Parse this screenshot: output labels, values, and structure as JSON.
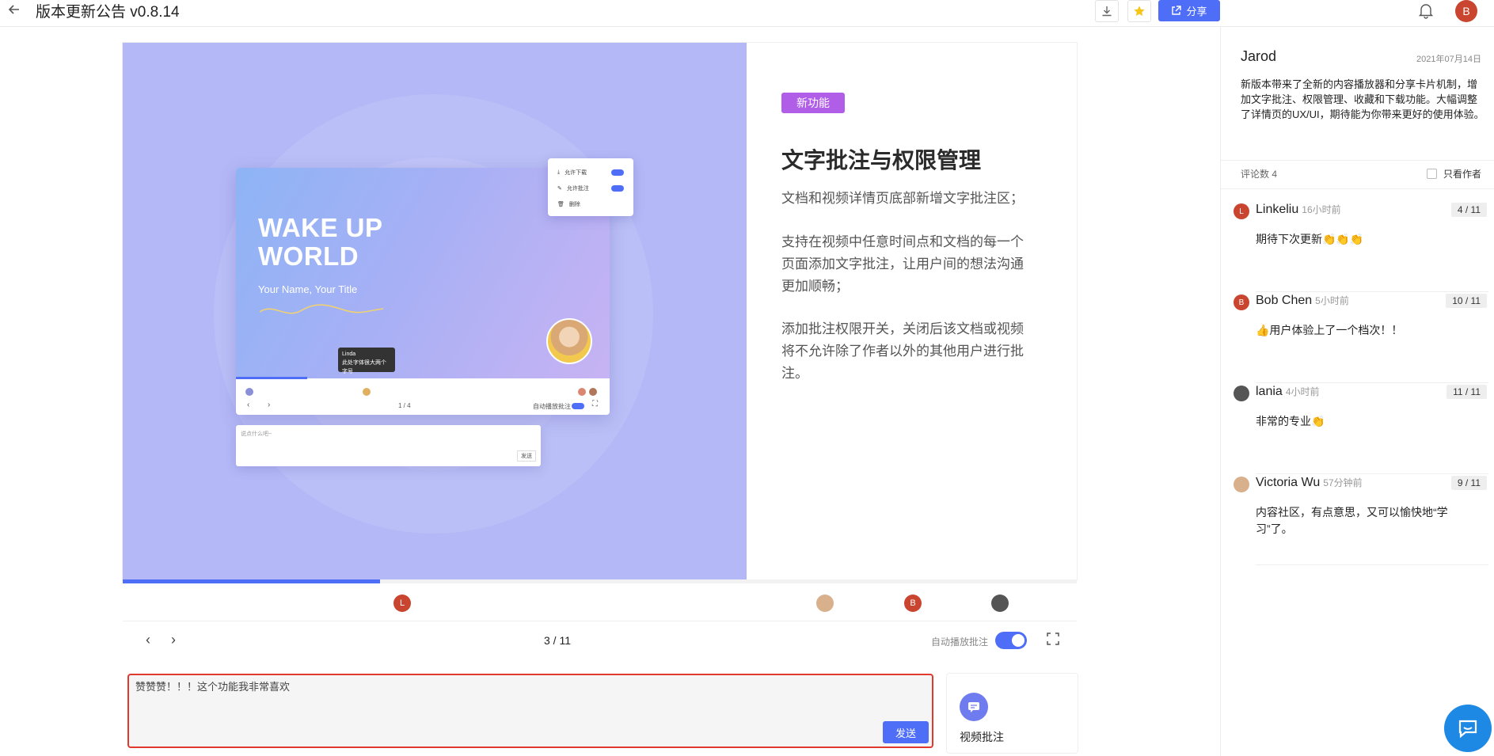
{
  "header": {
    "title": "版本更新公告 v0.8.14",
    "share_label": "分享",
    "user_initial": "B"
  },
  "slide": {
    "mock": {
      "headline_1": "WAKE UP",
      "headline_2": "WORLD",
      "subtitle": "Your Name, Your Title",
      "menu": [
        "允许下载",
        "允许批注",
        "删除"
      ],
      "tooltip_name": "Linda",
      "tooltip_text": "此处字体很大两个字号",
      "page": "1 / 4",
      "autoplay": "自动播放批注",
      "input_placeholder": "说点什么吧~",
      "send": "发送"
    },
    "badge": "新功能",
    "heading": "文字批注与权限管理",
    "paragraphs": [
      "文档和视频详情页底部新增文字批注区；",
      "支持在视频中任意时间点和文档的每一个页面添加文字批注，让用户间的想法沟通更加顺畅；",
      "添加批注权限开关，关闭后该文档或视频将不允许除了作者以外的其他用户进行批注。"
    ]
  },
  "player": {
    "progress_fraction": 0.27,
    "page_indicator": "3 / 11",
    "autoplay_label": "自动播放批注",
    "autoplay_on": true,
    "markers": [
      {
        "initial": "L",
        "color": "#c9452f"
      },
      {
        "initial": "",
        "color": "#d9b08c"
      },
      {
        "initial": "B",
        "color": "#c9452f"
      },
      {
        "initial": "",
        "color": "#555555"
      }
    ]
  },
  "comment_input": {
    "value": "赞赞赞！！！这个功能我非常喜欢",
    "send_label": "发送"
  },
  "video_annotation": {
    "label": "视频批注"
  },
  "panel": {
    "author": "Jarod",
    "date": "2021年07月14日",
    "description": "新版本带来了全新的内容播放器和分享卡片机制，增加文字批注、权限管理、收藏和下载功能。大幅调整了详情页的UX/UI，期待能为你带来更好的使用体验。",
    "comment_count": "评论数 4",
    "only_author": "只看作者",
    "comments": [
      {
        "initial": "L",
        "color": "#c9452f",
        "name": "Linkeliu",
        "time": "16小时前",
        "page": "4 / 11",
        "text": "期待下次更新👏👏👏"
      },
      {
        "initial": "B",
        "color": "#c9452f",
        "name": "Bob Chen",
        "time": "5小时前",
        "page": "10 / 11",
        "text": "👍用户体验上了一个档次！！"
      },
      {
        "initial": "",
        "color": "#555555",
        "name": "lania",
        "time": "4小时前",
        "page": "11 / 11",
        "text": "非常的专业👏"
      },
      {
        "initial": "",
        "color": "#d9b08c",
        "name": "Victoria Wu",
        "time": "57分钟前",
        "page": "9 / 11",
        "text": "内容社区，有点意思，又可以愉快地“学习”了。"
      }
    ]
  }
}
